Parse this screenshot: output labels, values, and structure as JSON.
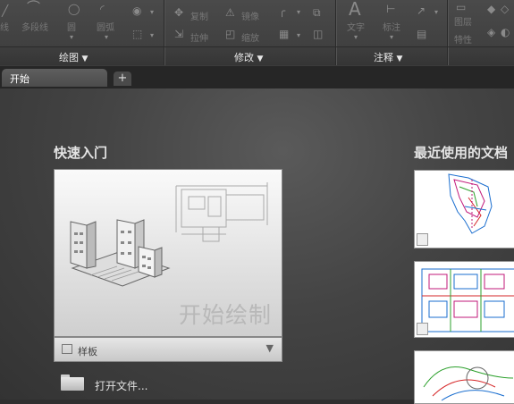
{
  "ribbon": {
    "tools": [
      {
        "name": "line",
        "label": "线"
      },
      {
        "name": "polyline",
        "label": "多段线"
      },
      {
        "name": "circle",
        "label": "圆"
      },
      {
        "name": "arc",
        "label": "圆弧"
      },
      {
        "name": "copy",
        "label": "复制"
      },
      {
        "name": "mirror",
        "label": "镜像"
      },
      {
        "name": "stretch",
        "label": "拉伸"
      },
      {
        "name": "scale",
        "label": "缩放"
      },
      {
        "name": "text",
        "label": "文字"
      },
      {
        "name": "dimension",
        "label": "标注"
      },
      {
        "name": "layer",
        "label": "图层"
      },
      {
        "name": "properties",
        "label": "特性"
      }
    ],
    "panels": [
      {
        "label": "绘图"
      },
      {
        "label": "修改"
      },
      {
        "label": "注释"
      }
    ]
  },
  "tabs": {
    "active": "开始",
    "add": "+"
  },
  "start": {
    "quick_start": "快速入门",
    "recent_docs": "最近使用的文档",
    "start_drawing": "开始绘制",
    "template_label": "样板",
    "template_dropdown": "▼",
    "open_files": "打开文件..."
  },
  "colors": {
    "background": "#2f2f2f",
    "ribbon": "#424242",
    "accent": "#e4e4e4"
  }
}
